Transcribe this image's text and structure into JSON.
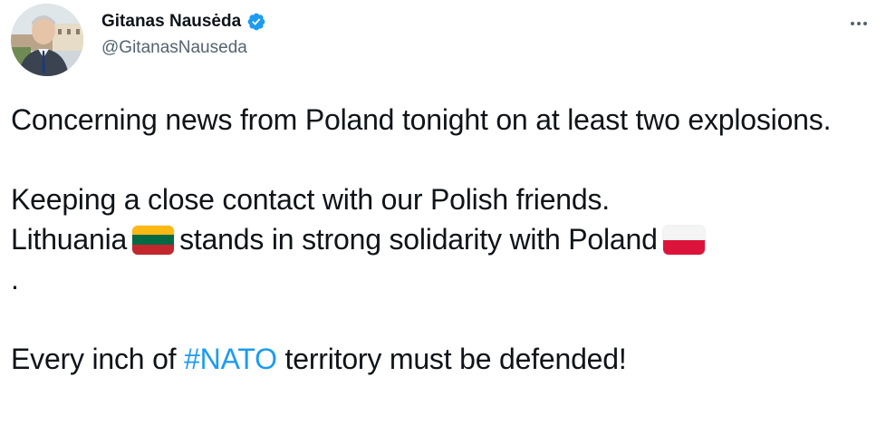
{
  "colors": {
    "text": "#0f1419",
    "secondary": "#536471",
    "link": "#1d9bf0",
    "verified": "#1d9bf0"
  },
  "author": {
    "display_name": "Gitanas Nausėda",
    "handle": "@GitanasNauseda",
    "verified": true,
    "avatar_icon": "profile-photo"
  },
  "more_icon": "more-dots-icon",
  "tweet": {
    "line1": "Concerning news from Poland tonight on at least two explosions.",
    "line2": "Keeping a close contact with our Polish friends.",
    "line3_part1": "Lithuania",
    "flag_lithuania": "lithuania-flag-icon",
    "line3_part2": "stands in strong solidarity with Poland",
    "flag_poland": "poland-flag-icon",
    "line3_end": ".",
    "line4_part1": "Every inch of",
    "hashtag": "#NATO",
    "line4_part2": "territory must be defended!"
  }
}
